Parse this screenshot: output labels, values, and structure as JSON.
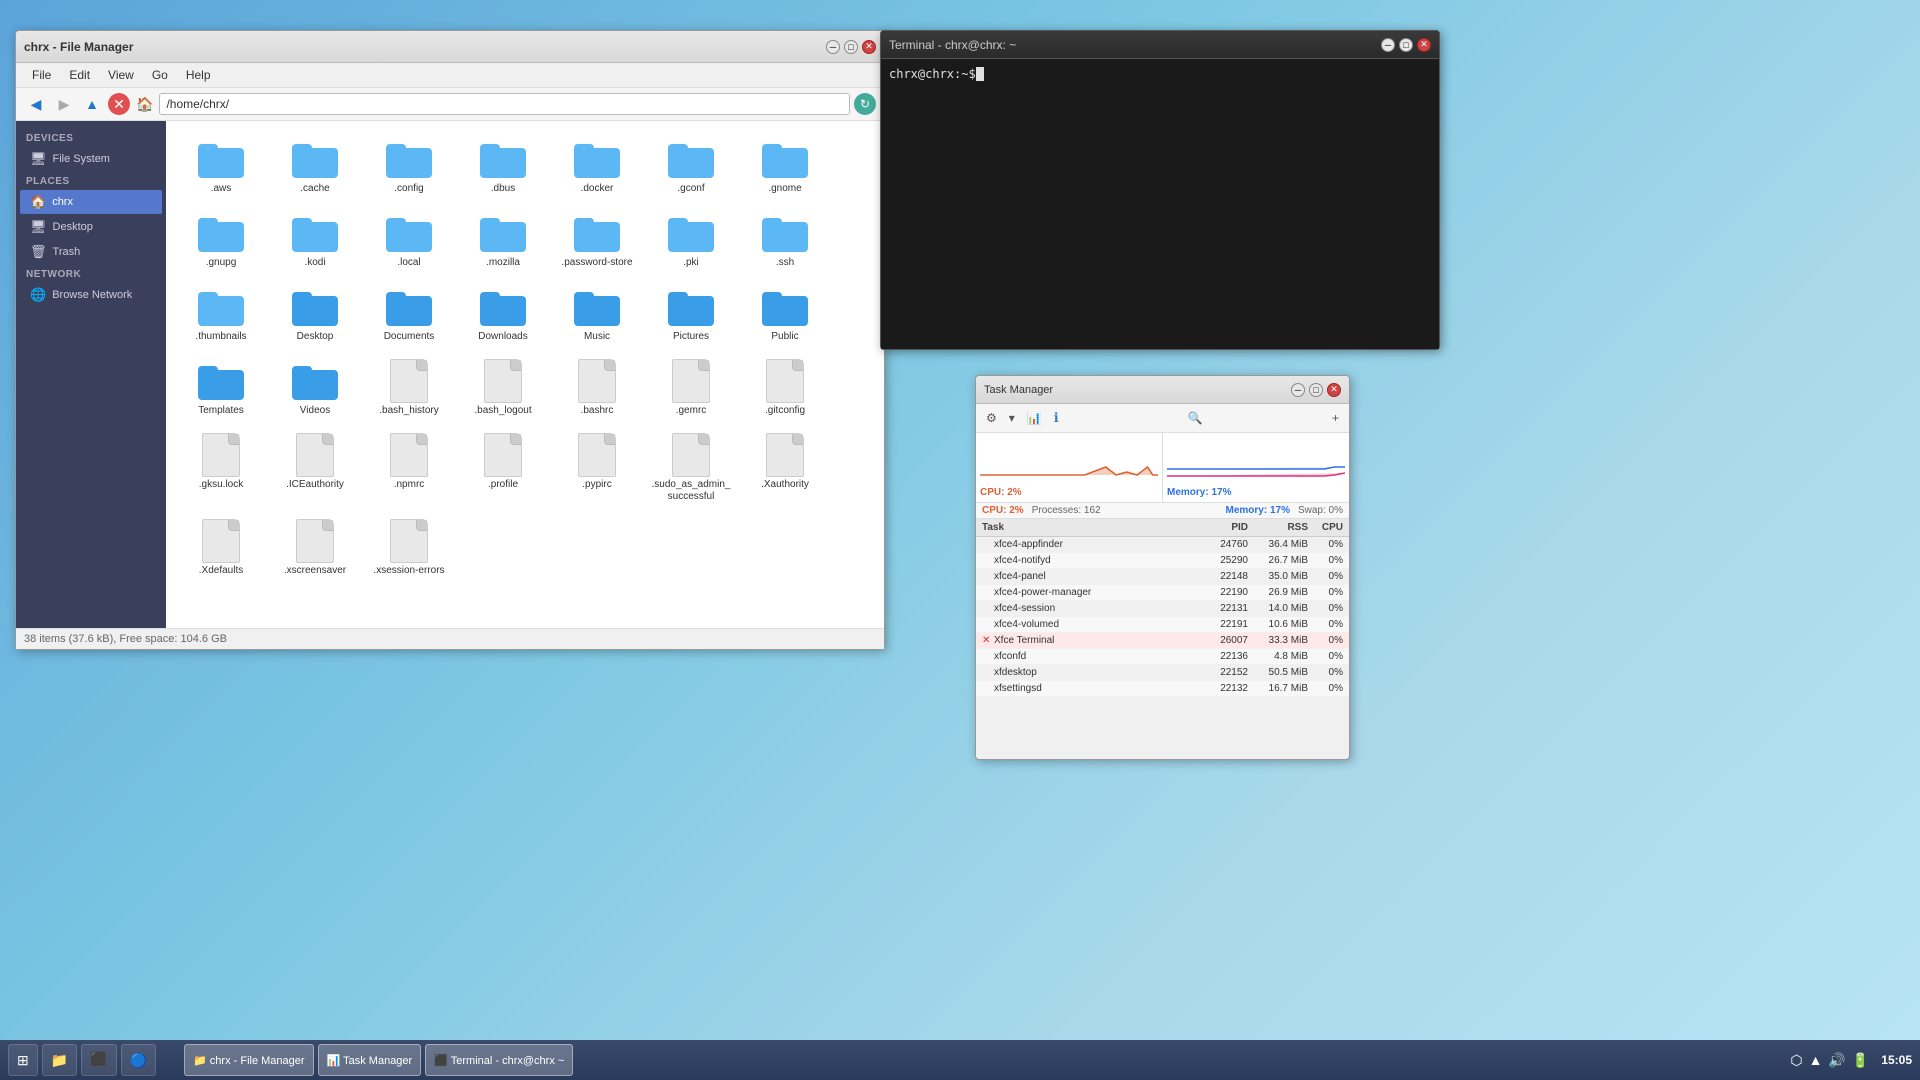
{
  "fileManager": {
    "title": "chrx - File Manager",
    "menuItems": [
      "File",
      "Edit",
      "View",
      "Go",
      "Help"
    ],
    "locationPath": "/home/chrx/",
    "statusBar": "38 items (37.6 kB), Free space: 104.6 GB",
    "sidebar": {
      "sections": [
        {
          "name": "DEVICES",
          "items": [
            {
              "label": "File System",
              "icon": "🖥",
              "active": false
            }
          ]
        },
        {
          "name": "PLACES",
          "items": [
            {
              "label": "chrx",
              "icon": "🏠",
              "active": true
            },
            {
              "label": "Desktop",
              "icon": "🖥",
              "active": false
            },
            {
              "label": "Trash",
              "icon": "🗑",
              "active": false
            }
          ]
        },
        {
          "name": "NETWORK",
          "items": [
            {
              "label": "Browse Network",
              "icon": "🌐",
              "active": false
            }
          ]
        }
      ]
    },
    "files": [
      {
        "name": ".aws",
        "type": "folder"
      },
      {
        "name": ".cache",
        "type": "folder"
      },
      {
        "name": ".config",
        "type": "folder"
      },
      {
        "name": ".dbus",
        "type": "folder"
      },
      {
        "name": ".docker",
        "type": "folder"
      },
      {
        "name": ".gconf",
        "type": "folder"
      },
      {
        "name": ".gnome",
        "type": "folder"
      },
      {
        "name": ".gnupg",
        "type": "folder"
      },
      {
        "name": ".kodi",
        "type": "folder"
      },
      {
        "name": ".local",
        "type": "folder"
      },
      {
        "name": ".mozilla",
        "type": "folder"
      },
      {
        "name": ".password-store",
        "type": "folder"
      },
      {
        "name": ".pki",
        "type": "folder"
      },
      {
        "name": ".ssh",
        "type": "folder"
      },
      {
        "name": ".thumbnails",
        "type": "folder"
      },
      {
        "name": "Desktop",
        "type": "folder-special"
      },
      {
        "name": "Documents",
        "type": "folder-special"
      },
      {
        "name": "Downloads",
        "type": "folder-special"
      },
      {
        "name": "Music",
        "type": "folder-special"
      },
      {
        "name": "Pictures",
        "type": "folder-special"
      },
      {
        "name": "Public",
        "type": "folder-special"
      },
      {
        "name": "Templates",
        "type": "folder-special"
      },
      {
        "name": "Videos",
        "type": "folder-special"
      },
      {
        "name": ".bash_history",
        "type": "file"
      },
      {
        "name": ".bash_logout",
        "type": "file"
      },
      {
        "name": ".bashrc",
        "type": "file"
      },
      {
        "name": ".gemrc",
        "type": "file"
      },
      {
        "name": ".gitconfig",
        "type": "file"
      },
      {
        "name": ".gksu.lock",
        "type": "file"
      },
      {
        "name": ".ICEauthority",
        "type": "file"
      },
      {
        "name": ".npmrc",
        "type": "file"
      },
      {
        "name": ".profile",
        "type": "file"
      },
      {
        "name": ".pypirc",
        "type": "file"
      },
      {
        "name": ".sudo_as_admin_successful",
        "type": "file"
      },
      {
        "name": ".Xauthority",
        "type": "file"
      },
      {
        "name": ".Xdefaults",
        "type": "file"
      },
      {
        "name": ".xscreensaver",
        "type": "file"
      },
      {
        "name": ".xsession-errors",
        "type": "file"
      }
    ]
  },
  "terminal": {
    "title": "Terminal - chrx@chrx: ~",
    "prompt": "chrx@chrx:~$"
  },
  "taskManager": {
    "title": "Task Manager",
    "stats": {
      "cpu": "CPU: 2%",
      "processes": "Processes: 162",
      "memory": "Memory: 17%",
      "swap": "Swap: 0%"
    },
    "columns": {
      "task": "Task",
      "pid": "PID",
      "rss": "RSS",
      "cpu": "CPU"
    },
    "processes": [
      {
        "name": "xfce4-appfinder",
        "pid": "24760",
        "rss": "36.4 MiB",
        "cpu": "0%",
        "highlight": false
      },
      {
        "name": "xfce4-notifyd",
        "pid": "25290",
        "rss": "26.7 MiB",
        "cpu": "0%",
        "highlight": false
      },
      {
        "name": "xfce4-panel",
        "pid": "22148",
        "rss": "35.0 MiB",
        "cpu": "0%",
        "highlight": false
      },
      {
        "name": "xfce4-power-manager",
        "pid": "22190",
        "rss": "26.9 MiB",
        "cpu": "0%",
        "highlight": false
      },
      {
        "name": "xfce4-session",
        "pid": "22131",
        "rss": "14.0 MiB",
        "cpu": "0%",
        "highlight": false
      },
      {
        "name": "xfce4-volumed",
        "pid": "22191",
        "rss": "10.6 MiB",
        "cpu": "0%",
        "highlight": false
      },
      {
        "name": "Xfce Terminal",
        "pid": "26007",
        "rss": "33.3 MiB",
        "cpu": "0%",
        "highlight": true
      },
      {
        "name": "xfconfd",
        "pid": "22136",
        "rss": "4.8 MiB",
        "cpu": "0%",
        "highlight": false
      },
      {
        "name": "xfdesktop",
        "pid": "22152",
        "rss": "50.5 MiB",
        "cpu": "0%",
        "highlight": false
      },
      {
        "name": "xfsettingsd",
        "pid": "22132",
        "rss": "16.7 MiB",
        "cpu": "0%",
        "highlight": false
      }
    ]
  },
  "taskbar": {
    "items": [
      {
        "icon": "⊞",
        "label": ""
      },
      {
        "icon": "📁",
        "label": ""
      },
      {
        "icon": ">_",
        "label": ""
      },
      {
        "icon": "●",
        "label": "",
        "isChrome": true
      }
    ],
    "windows": [
      {
        "label": "chrx - File Manager",
        "icon": "📁"
      },
      {
        "label": "Task Manager",
        "icon": "📊"
      },
      {
        "label": "Terminal - chrx@chrx ~",
        "icon": ">_"
      }
    ],
    "time": "15:05",
    "systray": {
      "bluetooth": "⬡",
      "wifi": "▲",
      "sound": "🔊",
      "power": "🔋"
    }
  }
}
